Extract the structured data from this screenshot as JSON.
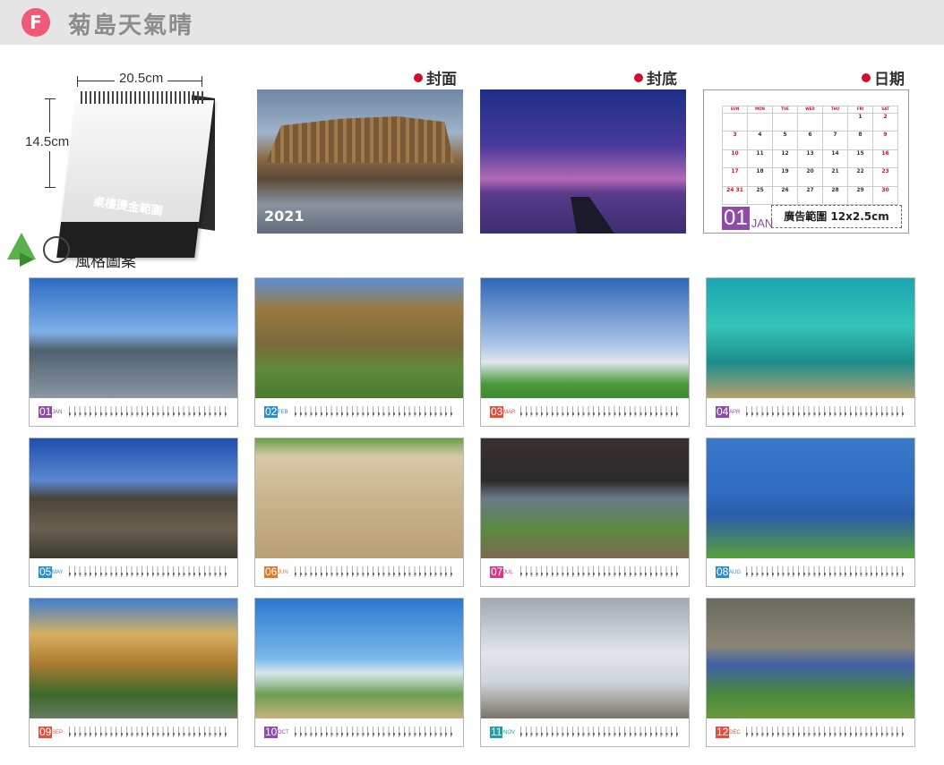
{
  "header": {
    "badge": "F",
    "title": "菊島天氣晴"
  },
  "mockup": {
    "width_label": "20.5cm",
    "height_label": "14.5cm",
    "gold_label": "桌檯燙金範圍"
  },
  "sections": {
    "cover": "封面",
    "back": "封底",
    "date": "日期"
  },
  "cover_year": "2021",
  "date_card": {
    "weekdays": [
      "SUN",
      "MON",
      "TUE",
      "WED",
      "THU",
      "FRI",
      "SAT"
    ],
    "rows": [
      [
        "",
        "",
        "",
        "",
        "",
        "1",
        "2"
      ],
      [
        "3",
        "4",
        "5",
        "6",
        "7",
        "8",
        "9"
      ],
      [
        "10",
        "11",
        "12",
        "13",
        "14",
        "15",
        "16"
      ],
      [
        "17",
        "18",
        "19",
        "20",
        "21",
        "22",
        "23"
      ],
      [
        "24 31",
        "25",
        "26",
        "27",
        "28",
        "29",
        "30"
      ]
    ],
    "month_num": "01",
    "month_name": "JAN",
    "ad_text": "廣告範圍 12x2.5cm"
  },
  "style_label": "風格圖案",
  "months": [
    {
      "num": "01",
      "name": "JAN",
      "color": "#8e4ca8"
    },
    {
      "num": "02",
      "name": "FEB",
      "color": "#2b8fd1"
    },
    {
      "num": "03",
      "name": "MAR",
      "color": "#e0503a"
    },
    {
      "num": "04",
      "name": "APR",
      "color": "#8e4ca8"
    },
    {
      "num": "05",
      "name": "MAY",
      "color": "#2b8fd1"
    },
    {
      "num": "06",
      "name": "JUN",
      "color": "#e07a2a"
    },
    {
      "num": "07",
      "name": "JUL",
      "color": "#d83a8a"
    },
    {
      "num": "08",
      "name": "AUG",
      "color": "#2b8fd1"
    },
    {
      "num": "09",
      "name": "SEP",
      "color": "#e0503a"
    },
    {
      "num": "10",
      "name": "OCT",
      "color": "#8e4ca8"
    },
    {
      "num": "11",
      "name": "NOV",
      "color": "#1aa0a8"
    },
    {
      "num": "12",
      "name": "DEC",
      "color": "#e0503a"
    }
  ]
}
